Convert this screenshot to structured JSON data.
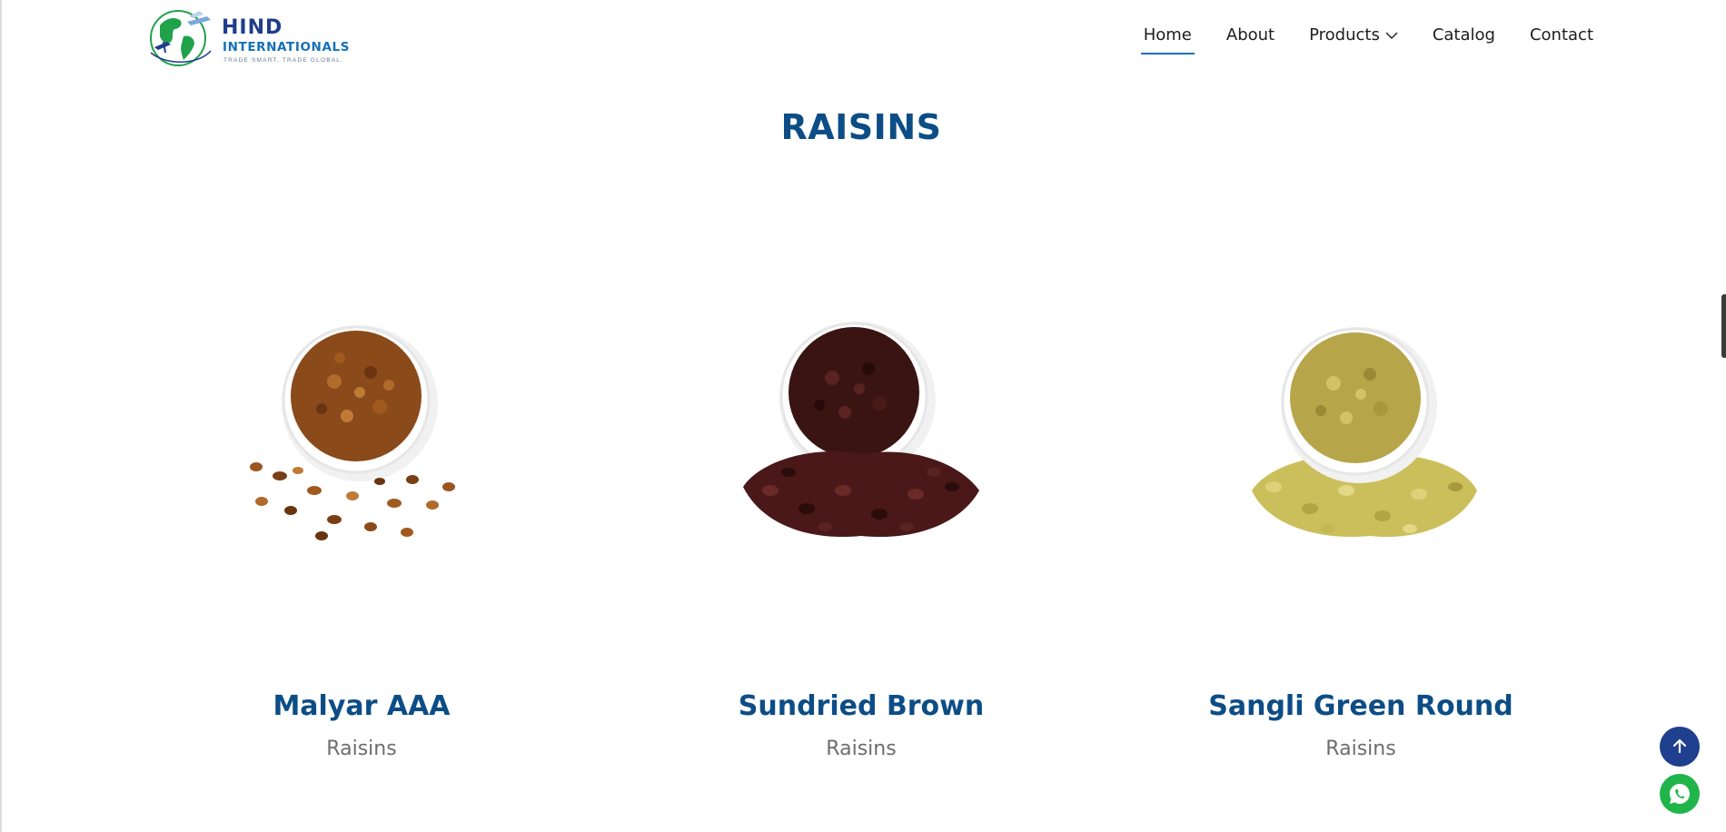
{
  "brand": {
    "name": "HIND",
    "sub": "INTERNATIONALS",
    "tagline": "TRADE SMART, TRADE GLOBAL."
  },
  "nav": [
    {
      "label": "Home",
      "active": true
    },
    {
      "label": "About"
    },
    {
      "label": "Products",
      "has_dropdown": true
    },
    {
      "label": "Catalog"
    },
    {
      "label": "Contact"
    }
  ],
  "section": {
    "title": "RAISINS"
  },
  "products": [
    {
      "name": "Malyar AAA",
      "category": "Raisins",
      "color": "#8a4a1a"
    },
    {
      "name": "Sundried Brown",
      "category": "Raisins",
      "color": "#3a1412"
    },
    {
      "name": "Sangli Green Round",
      "category": "Raisins",
      "color": "#b7a54a"
    }
  ],
  "floating": {
    "scroll_top_icon": "arrow-up-icon",
    "whatsapp_icon": "whatsapp-icon"
  },
  "colors": {
    "primary": "#0d4d86",
    "accent": "#1570b8",
    "scroll_btn": "#1f3f8f",
    "whatsapp": "#20b54a"
  }
}
